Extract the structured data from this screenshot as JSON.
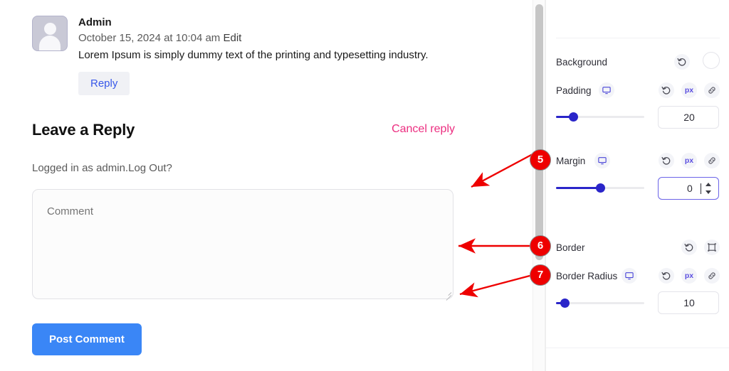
{
  "comment": {
    "avatar_alt": "default-avatar",
    "author": "Admin",
    "date": "October 15, 2024 at 10:04 am",
    "edit_label": "Edit",
    "body": "Lorem Ipsum is simply dummy text of the printing and typesetting industry.",
    "reply_label": "Reply"
  },
  "reply_form": {
    "title": "Leave a Reply",
    "cancel_label": "Cancel reply",
    "logged_in_text": "Logged in as admin.",
    "logout_label": "Log Out?",
    "comment_placeholder": "Comment",
    "comment_value": "",
    "submit_label": "Post Comment"
  },
  "style_panel": {
    "background": {
      "label": "Background",
      "reset_icon": "reset-icon",
      "swatch_color": "#ffffff"
    },
    "padding": {
      "label": "Padding",
      "device_icon": "desktop-icon",
      "reset_icon": "reset-icon",
      "unit": "px",
      "link_icon": "link-icon",
      "value": "20",
      "slider_percent": 20
    },
    "margin": {
      "label": "Margin",
      "device_icon": "desktop-icon",
      "reset_icon": "reset-icon",
      "unit": "px",
      "link_icon": "link-icon",
      "value": "0",
      "slider_percent": 50,
      "focused": true
    },
    "border": {
      "label": "Border",
      "reset_icon": "reset-icon",
      "frame_icon": "border-frame-icon"
    },
    "border_radius": {
      "label": "Border Radius",
      "device_icon": "desktop-icon",
      "reset_icon": "reset-icon",
      "unit": "px",
      "link_icon": "link-icon",
      "value": "10",
      "slider_percent": 10
    }
  },
  "annotations": {
    "badges": [
      {
        "number": "5",
        "target": "margin-row"
      },
      {
        "number": "6",
        "target": "border-row"
      },
      {
        "number": "7",
        "target": "border-radius-row"
      }
    ],
    "arrow_color": "#ee0000"
  },
  "colors": {
    "accent_blue": "#3858e9",
    "button_blue": "#3a86f6",
    "pink": "#ec2e80",
    "slider_blue": "#2a25c9",
    "badge_red": "#ee0000"
  }
}
